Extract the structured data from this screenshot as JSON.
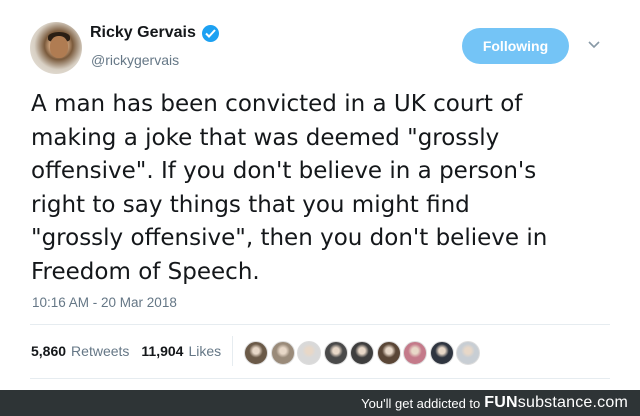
{
  "user": {
    "display_name": "Ricky Gervais",
    "handle": "@rickygervais",
    "verified": true
  },
  "follow_button": {
    "label": "Following"
  },
  "tweet": {
    "lines": [
      "A man has been convicted in a UK court of",
      "making a joke that was deemed \"grossly",
      "offensive\". If you don't believe in a person's",
      "right to say things that you might find",
      "\"grossly offensive\", then you don't believe in",
      "Freedom of Speech."
    ],
    "timestamp": "10:16 AM - 20 Mar 2018"
  },
  "stats": {
    "retweets_count": "5,860",
    "retweets_label": "Retweets",
    "likes_count": "11,904",
    "likes_label": "Likes"
  },
  "likers": [
    {
      "color": "#6b5a48"
    },
    {
      "color": "#9a8b7a"
    },
    {
      "color": "#d9d9d9"
    },
    {
      "color": "#4a4a4a"
    },
    {
      "color": "#3e3e3e"
    },
    {
      "color": "#5a4636"
    },
    {
      "color": "#c47a8a"
    },
    {
      "color": "#2f3540"
    },
    {
      "color": "#c8ced4"
    }
  ],
  "footer": {
    "tagline": "You'll get addicted to",
    "brand_bold": "FUN",
    "brand_light": "substance",
    "brand_suffix": ".com"
  },
  "colors": {
    "accent": "#1da1f2",
    "follow_button_bg": "#74c4f6",
    "footer_bg": "#2e3436"
  }
}
